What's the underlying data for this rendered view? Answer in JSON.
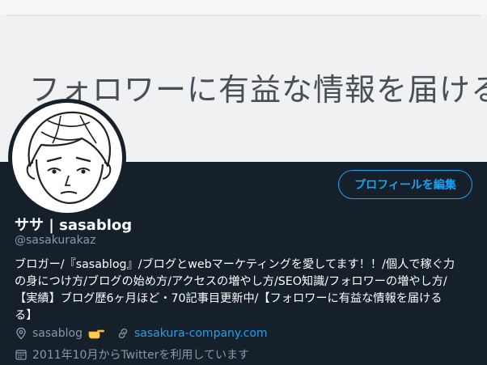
{
  "banner": {
    "text": "フォロワーに有益な情報を届ける"
  },
  "profile": {
    "name": "ササ | sasablog",
    "handle": "@sasakurakaz",
    "edit_button_label": "プロフィールを編集",
    "bio_lines": [
      "ブロガー/『sasablog』/ブログとwebマーケティングを愛してます！！/個人で稼ぐ力",
      "の身につけ方/ブログの始め方/アクセスの増やし方/SEO知識/フォロワーの増やし方/",
      "【実績】ブログ歴6ヶ月ほど・70記事目更新中/【フォロワーに有益な情報を届ける",
      "る】"
    ],
    "location": "sasablog",
    "location_emoji": "pointing-hand-icon",
    "website": "sasakura-company.com",
    "joined": "2011年10月からTwitterを利用しています"
  },
  "colors": {
    "background": "#15202b",
    "accent": "#1da1f2",
    "secondary_text": "#8899a6",
    "primary_text": "#ffffff"
  }
}
